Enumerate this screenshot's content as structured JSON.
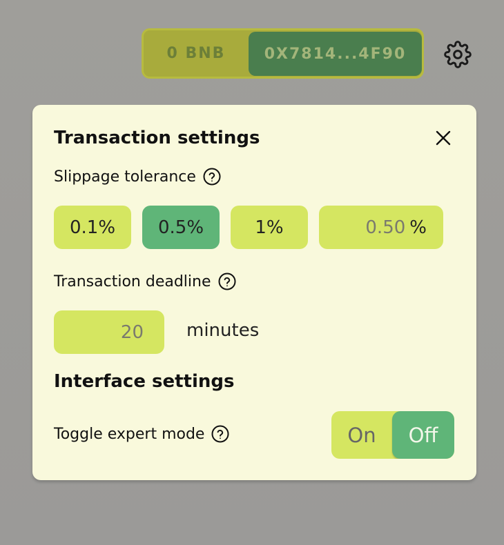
{
  "wallet": {
    "balance": "0 BNB",
    "address": "0X7814...4F90"
  },
  "icons": {
    "settings": "gear-icon",
    "close": "close-icon",
    "help": "help-circle-icon"
  },
  "colors": {
    "modal_bg": "#f9f9dc",
    "option_bg": "#d5e661",
    "active_bg": "#5fb578",
    "wallet_bg": "#a8ab3c",
    "address_bg": "#4a7e4e"
  },
  "modal": {
    "title": "Transaction settings",
    "slippage": {
      "label": "Slippage tolerance",
      "options": [
        "0.1%",
        "0.5%",
        "1%"
      ],
      "selected": "0.5%",
      "custom_placeholder": "0.50",
      "custom_suffix": "%"
    },
    "deadline": {
      "label": "Transaction deadline",
      "placeholder": "20",
      "unit": "minutes"
    },
    "interface": {
      "title": "Interface settings",
      "expert_mode_label": "Toggle expert mode",
      "on_label": "On",
      "off_label": "Off",
      "selected": "Off"
    }
  }
}
